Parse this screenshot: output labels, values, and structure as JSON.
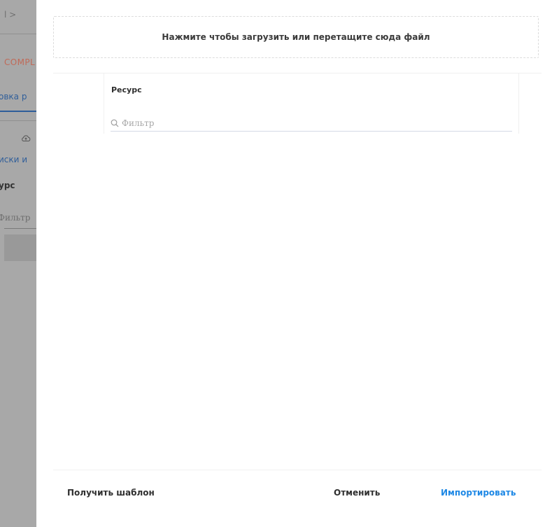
{
  "background_page": {
    "breadcrumb_fragment": "l  >",
    "company_fragment": "COMPL",
    "tab_fragment": "овка р",
    "link_fragment": "иски и",
    "resource_fragment": "урс",
    "filter_fragment": "Фильтр"
  },
  "modal": {
    "dropzone_text": "Нажмите чтобы загрузить или перетащите сюда файл",
    "table": {
      "column_header": "Ресурс",
      "filter_placeholder": "Фильтр",
      "filter_value": ""
    },
    "footer": {
      "get_template_label": "Получить шаблон",
      "cancel_label": "Отменить",
      "import_label": "Импортировать"
    }
  },
  "colors": {
    "accent": "#1e88e5",
    "overlay": "#9a9a9a"
  },
  "icons": [
    "cloud-upload-icon",
    "search-icon"
  ]
}
